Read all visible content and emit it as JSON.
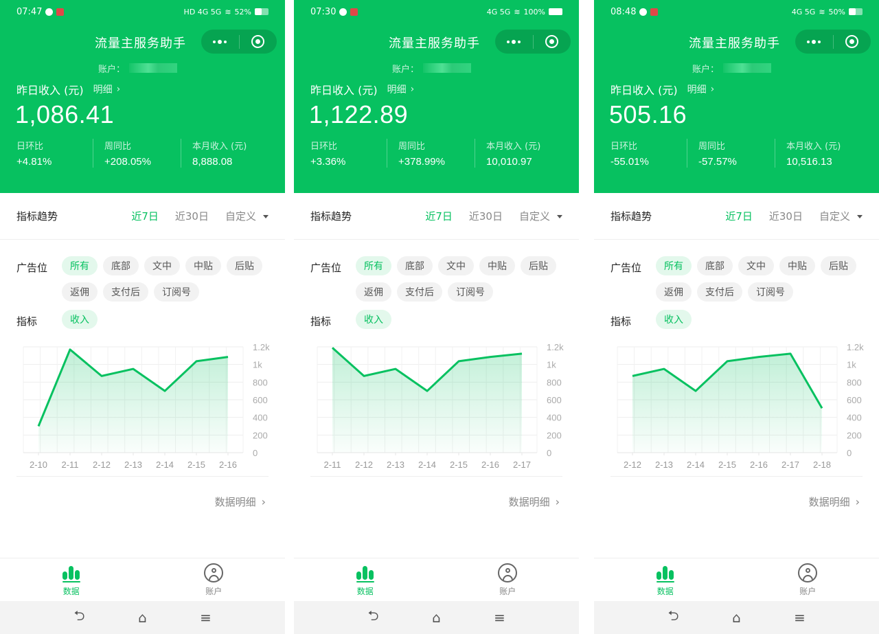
{
  "colors": {
    "brand": "#07c160",
    "header_bg": "#07c160",
    "chip_active_bg": "#e3f8ec"
  },
  "screens": [
    {
      "status": {
        "time": "07:47",
        "indicators": "HD 4G 5G",
        "battery": "52%",
        "battery_level": 0.52
      },
      "nav_title": "流量主服务助手",
      "account_label": "账户：",
      "income_label": "昨日收入 (元)",
      "detail_link": "明细",
      "amount": "1,086.41",
      "stats": [
        {
          "label": "日环比",
          "value": "+4.81%"
        },
        {
          "label": "周同比",
          "value": "+208.05%"
        },
        {
          "label": "本月收入 (元)",
          "value": "8,888.08"
        }
      ],
      "trend_title": "指标趋势",
      "ranges": [
        {
          "label": "近7日",
          "active": true
        },
        {
          "label": "近30日",
          "active": false
        },
        {
          "label": "自定义",
          "active": false
        }
      ],
      "ad_label": "广告位",
      "ad_chips": [
        {
          "label": "所有",
          "active": true
        },
        {
          "label": "底部"
        },
        {
          "label": "文中"
        },
        {
          "label": "中贴"
        },
        {
          "label": "后贴"
        },
        {
          "label": "返佣"
        },
        {
          "label": "支付后"
        },
        {
          "label": "订阅号"
        }
      ],
      "metric_label": "指标",
      "metric_chips": [
        {
          "label": "收入",
          "active": true
        }
      ],
      "data_detail": "数据明细",
      "tabs": [
        {
          "label": "数据",
          "active": true
        },
        {
          "label": "账户",
          "active": false
        }
      ]
    },
    {
      "status": {
        "time": "07:30",
        "indicators": "4G 5G",
        "battery": "100%",
        "battery_level": 1.0
      },
      "nav_title": "流量主服务助手",
      "account_label": "账户：",
      "income_label": "昨日收入 (元)",
      "detail_link": "明细",
      "amount": "1,122.89",
      "stats": [
        {
          "label": "日环比",
          "value": "+3.36%"
        },
        {
          "label": "周同比",
          "value": "+378.99%"
        },
        {
          "label": "本月收入 (元)",
          "value": "10,010.97"
        }
      ],
      "trend_title": "指标趋势",
      "ranges": [
        {
          "label": "近7日",
          "active": true
        },
        {
          "label": "近30日",
          "active": false
        },
        {
          "label": "自定义",
          "active": false
        }
      ],
      "ad_label": "广告位",
      "ad_chips": [
        {
          "label": "所有",
          "active": true
        },
        {
          "label": "底部"
        },
        {
          "label": "文中"
        },
        {
          "label": "中贴"
        },
        {
          "label": "后贴"
        },
        {
          "label": "返佣"
        },
        {
          "label": "支付后"
        },
        {
          "label": "订阅号"
        }
      ],
      "metric_label": "指标",
      "metric_chips": [
        {
          "label": "收入",
          "active": true
        }
      ],
      "data_detail": "数据明细",
      "tabs": [
        {
          "label": "数据",
          "active": true
        },
        {
          "label": "账户",
          "active": false
        }
      ]
    },
    {
      "status": {
        "time": "08:48",
        "indicators": "4G 5G",
        "battery": "50%",
        "battery_level": 0.5
      },
      "nav_title": "流量主服务助手",
      "account_label": "账户：",
      "income_label": "昨日收入 (元)",
      "detail_link": "明细",
      "amount": "505.16",
      "stats": [
        {
          "label": "日环比",
          "value": "-55.01%"
        },
        {
          "label": "周同比",
          "value": "-57.57%"
        },
        {
          "label": "本月收入 (元)",
          "value": "10,516.13"
        }
      ],
      "trend_title": "指标趋势",
      "ranges": [
        {
          "label": "近7日",
          "active": true
        },
        {
          "label": "近30日",
          "active": false
        },
        {
          "label": "自定义",
          "active": false
        }
      ],
      "ad_label": "广告位",
      "ad_chips": [
        {
          "label": "所有",
          "active": true
        },
        {
          "label": "底部"
        },
        {
          "label": "文中"
        },
        {
          "label": "中贴"
        },
        {
          "label": "后贴"
        },
        {
          "label": "返佣"
        },
        {
          "label": "支付后"
        },
        {
          "label": "订阅号"
        }
      ],
      "metric_label": "指标",
      "metric_chips": [
        {
          "label": "收入",
          "active": true
        }
      ],
      "data_detail": "数据明细",
      "tabs": [
        {
          "label": "数据",
          "active": true
        },
        {
          "label": "账户",
          "active": false
        }
      ]
    }
  ],
  "chart_data": [
    {
      "type": "area",
      "title": "",
      "xlabel": "",
      "ylabel": "",
      "categories": [
        "2-10",
        "2-11",
        "2-12",
        "2-13",
        "2-14",
        "2-15",
        "2-16"
      ],
      "series": [
        {
          "name": "收入",
          "values": [
            300,
            1170,
            870,
            950,
            700,
            1037,
            1086
          ]
        }
      ],
      "yticks": [
        "0",
        "200",
        "400",
        "600",
        "800",
        "1k",
        "1.2k"
      ],
      "ylim": [
        0,
        1200
      ],
      "grid": true,
      "y_axis_side": "right"
    },
    {
      "type": "area",
      "title": "",
      "xlabel": "",
      "ylabel": "",
      "categories": [
        "2-11",
        "2-12",
        "2-13",
        "2-14",
        "2-15",
        "2-16",
        "2-17"
      ],
      "series": [
        {
          "name": "收入",
          "values": [
            1190,
            870,
            950,
            700,
            1037,
            1086,
            1123
          ]
        }
      ],
      "yticks": [
        "0",
        "200",
        "400",
        "600",
        "800",
        "1k",
        "1.2k"
      ],
      "ylim": [
        0,
        1200
      ],
      "grid": true,
      "y_axis_side": "right"
    },
    {
      "type": "area",
      "title": "",
      "xlabel": "",
      "ylabel": "",
      "categories": [
        "2-12",
        "2-13",
        "2-14",
        "2-15",
        "2-16",
        "2-17",
        "2-18"
      ],
      "series": [
        {
          "name": "收入",
          "values": [
            870,
            950,
            700,
            1037,
            1086,
            1123,
            505
          ]
        }
      ],
      "yticks": [
        "0",
        "200",
        "400",
        "600",
        "800",
        "1k",
        "1.2k"
      ],
      "ylim": [
        0,
        1200
      ],
      "grid": true,
      "y_axis_side": "right"
    }
  ]
}
